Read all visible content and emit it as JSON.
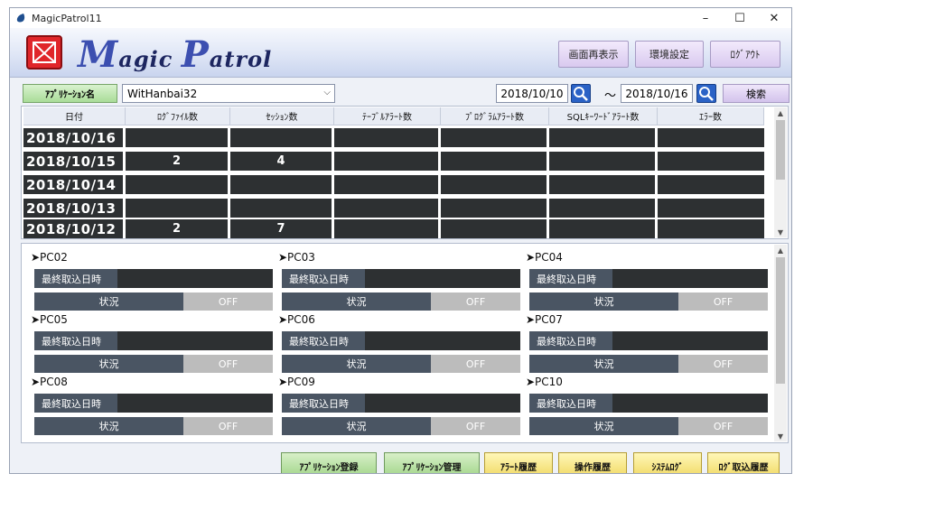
{
  "window": {
    "title": "MagicPatrol11",
    "controls": [
      "–",
      "☐",
      "✕"
    ]
  },
  "logo": {
    "part1_big": "M",
    "part1_small": "agic ",
    "part2_big": "P",
    "part2_small": "atrol"
  },
  "toolbar": {
    "refresh": "画面再表示",
    "settings": "環境設定",
    "logout": "ﾛｸﾞｱｳﾄ"
  },
  "filter": {
    "app_label": "ｱﾌﾟﾘｹｰｼｮﾝ名",
    "app_value": "WitHanbai32",
    "date_from": "2018/10/10",
    "tilde": "～",
    "date_to": "2018/10/16",
    "search": "検索"
  },
  "grid": {
    "headers": [
      "日付",
      "ﾛｸﾞﾌｧｲﾙ数",
      "ｾｯｼｮﾝ数",
      "ﾃｰﾌﾞﾙｱﾗｰﾄ数",
      "ﾌﾟﾛｸﾞﾗﾑｱﾗｰﾄ数",
      "SQLｷｰﾜｰﾄﾞｱﾗｰﾄ数",
      "ｴﾗｰ数"
    ],
    "rows": [
      [
        "2018/10/16",
        "",
        "",
        "",
        "",
        "",
        ""
      ],
      [
        "2018/10/15",
        "2",
        "4",
        "",
        "",
        "",
        ""
      ],
      [
        "2018/10/14",
        "",
        "",
        "",
        "",
        "",
        ""
      ],
      [
        "2018/10/13",
        "",
        "",
        "",
        "",
        "",
        ""
      ],
      [
        "2018/10/12",
        "2",
        "7",
        "",
        "",
        "",
        ""
      ]
    ]
  },
  "pcs": [
    {
      "name": "➤PC02",
      "last_label": "最終取込日時",
      "status_label": "状況",
      "status": "OFF"
    },
    {
      "name": "➤PC03",
      "last_label": "最終取込日時",
      "status_label": "状況",
      "status": "OFF"
    },
    {
      "name": "➤PC04",
      "last_label": "最終取込日時",
      "status_label": "状況",
      "status": "OFF"
    },
    {
      "name": "➤PC05",
      "last_label": "最終取込日時",
      "status_label": "状況",
      "status": "OFF"
    },
    {
      "name": "➤PC06",
      "last_label": "最終取込日時",
      "status_label": "状況",
      "status": "OFF"
    },
    {
      "name": "➤PC07",
      "last_label": "最終取込日時",
      "status_label": "状況",
      "status": "OFF"
    },
    {
      "name": "➤PC08",
      "last_label": "最終取込日時",
      "status_label": "状況",
      "status": "OFF"
    },
    {
      "name": "➤PC09",
      "last_label": "最終取込日時",
      "status_label": "状況",
      "status": "OFF"
    },
    {
      "name": "➤PC10",
      "last_label": "最終取込日時",
      "status_label": "状況",
      "status": "OFF"
    }
  ],
  "bottom": {
    "app_register": "ｱﾌﾟﾘｹｰｼｮﾝ登録",
    "app_manage": "ｱﾌﾟﾘｹｰｼｮﾝ管理",
    "alert_history": "ｱﾗｰﾄ履歴",
    "op_history": "操作履歴",
    "system_log": "ｼｽﾃﾑﾛｸﾞ",
    "log_import_history": "ﾛｸﾞ取込履歴"
  },
  "icons": {
    "title": "droplet-icon",
    "logo": "magicpatrol-logo-icon",
    "search": "magnifier-icon"
  },
  "colors": {
    "accent_green": "#a9dc98",
    "accent_yellow": "#f0d860",
    "accent_purple": "#d9c9ef",
    "cell_dark": "#2d3032",
    "status_off": "#bcbcbc"
  }
}
